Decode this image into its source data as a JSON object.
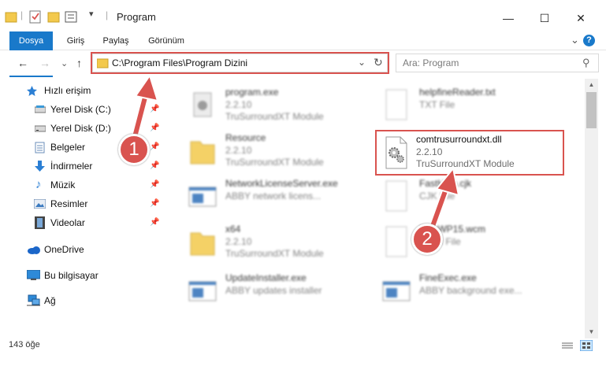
{
  "window": {
    "title": "Program",
    "minimize": "—",
    "maximize": "☐",
    "close": "✕"
  },
  "ribbon": {
    "tabs": [
      "Dosya",
      "Giriş",
      "Paylaş",
      "Görünüm"
    ],
    "expand": "⌄",
    "help": "?"
  },
  "nav": {
    "back": "←",
    "forward": "→",
    "recent": "⌄",
    "up": "↑",
    "address": "C:\\Program Files\\Program Dizini",
    "address_dropdown": "⌄",
    "refresh": "↻",
    "search_placeholder": "Ara: Program",
    "search_icon": "⚲"
  },
  "sidebar": {
    "items": [
      {
        "label": "Hızlı erişim",
        "icon": "star-icon",
        "pinned": false
      },
      {
        "label": "Yerel Disk (C:)",
        "icon": "drive-icon",
        "pinned": true
      },
      {
        "label": "Yerel Disk (D:)",
        "icon": "drive-icon",
        "pinned": true
      },
      {
        "label": "Belgeler",
        "icon": "documents-icon",
        "pinned": true
      },
      {
        "label": "İndirmeler",
        "icon": "download-icon",
        "pinned": true
      },
      {
        "label": "Müzik",
        "icon": "music-icon",
        "pinned": true
      },
      {
        "label": "Resimler",
        "icon": "pictures-icon",
        "pinned": true
      },
      {
        "label": "Videolar",
        "icon": "videos-icon",
        "pinned": true
      },
      {
        "label": "OneDrive",
        "icon": "cloud-icon",
        "pinned": false
      },
      {
        "label": "Bu bilgisayar",
        "icon": "computer-icon",
        "pinned": false
      },
      {
        "label": "Ağ",
        "icon": "network-icon",
        "pinned": false
      }
    ],
    "pin_glyph": "📌"
  },
  "files": [
    {
      "name": "program.exe",
      "version": "2.2.10",
      "desc": "TruSurroundXT Module",
      "icon": "exe-icon"
    },
    {
      "name": "helpfineReader.txt",
      "version": "TXT File",
      "desc": "",
      "icon": "text-file-icon"
    },
    {
      "name": "Resource",
      "version": "2.2.10",
      "desc": "TruSurroundXT Module",
      "icon": "folder-icon"
    },
    {
      "name": "comtrusurroundxt.dll",
      "version": "2.2.10",
      "desc": "TruSurroundXT Module",
      "icon": "dll-gear-icon"
    },
    {
      "name": "NetworkLicenseServer.exe",
      "version": "ABBY network licens...",
      "desc": "",
      "icon": "app-window-icon"
    },
    {
      "name": "FastHelp.cjk",
      "version": "CJK File",
      "desc": "",
      "icon": "file-icon"
    },
    {
      "name": "x64",
      "version": "2.2.10",
      "desc": "TruSurroundXT Module",
      "icon": "folder-icon"
    },
    {
      "name": "FineWP15.wcm",
      "version": "WCM File",
      "desc": "",
      "icon": "file-icon"
    },
    {
      "name": "UpdateInstaller.exe",
      "version": "ABBY updates installer",
      "desc": "",
      "icon": "app-window-icon"
    },
    {
      "name": "FineExec.exe",
      "version": "ABBY background exe...",
      "desc": "",
      "icon": "app-window-icon"
    }
  ],
  "callouts": [
    "1",
    "2"
  ],
  "status": {
    "count": "143 öğe"
  },
  "colors": {
    "accent": "#1979ca",
    "highlight": "#d9534f",
    "selected": "#cce8ff",
    "folder": "#f3c94c"
  }
}
